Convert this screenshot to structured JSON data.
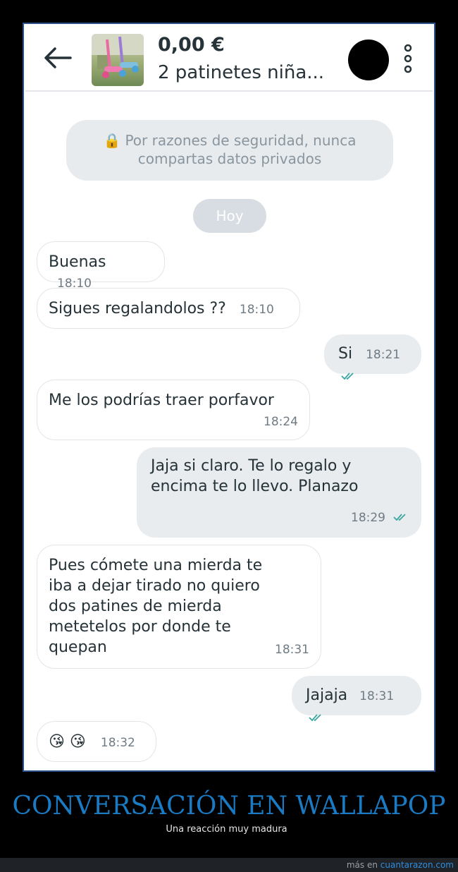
{
  "header": {
    "price": "0,00 €",
    "title": "2 patinetes niña...",
    "back_icon": "arrow-left-icon",
    "more_icon": "more-vertical-icon"
  },
  "safety_notice": {
    "icon": "🔒",
    "line1": "Por razones de seguridad, nunca",
    "line2": "compartas datos privados"
  },
  "day_label": "Hoy",
  "messages": [
    {
      "dir": "in",
      "text": "Buenas",
      "time": "18:10"
    },
    {
      "dir": "in",
      "text": "Sigues regalandolos ??",
      "time": "18:10"
    },
    {
      "dir": "out",
      "text": "Si",
      "time": "18:21",
      "read": true
    },
    {
      "dir": "in",
      "text": "Me los podrías traer porfavor",
      "time": "18:24"
    },
    {
      "dir": "out",
      "lines": [
        "Jaja si claro. Te lo regalo y",
        "encima te lo llevo. Planazo"
      ],
      "time": "18:29",
      "read": true
    },
    {
      "dir": "in",
      "lines": [
        "Pues cómete una mierda te",
        "iba a dejar tirado no quiero",
        "dos patines de mierda",
        "metetelos por donde te",
        "quepan"
      ],
      "time": "18:31"
    },
    {
      "dir": "out",
      "text": "Jajaja",
      "time": "18:31",
      "read": true
    },
    {
      "dir": "in",
      "text": "😘 😘",
      "time": "18:32"
    }
  ],
  "caption": {
    "title": "CONVERSACIÓN EN WALLAPOP",
    "subtitle": "Una reacción muy madura"
  },
  "footer": {
    "prefix": "más en",
    "link": "cuantarazon.com"
  },
  "colors": {
    "tick": "#3aa6a0",
    "caption": "#1a7bc4",
    "frame": "#2d4f8a"
  }
}
